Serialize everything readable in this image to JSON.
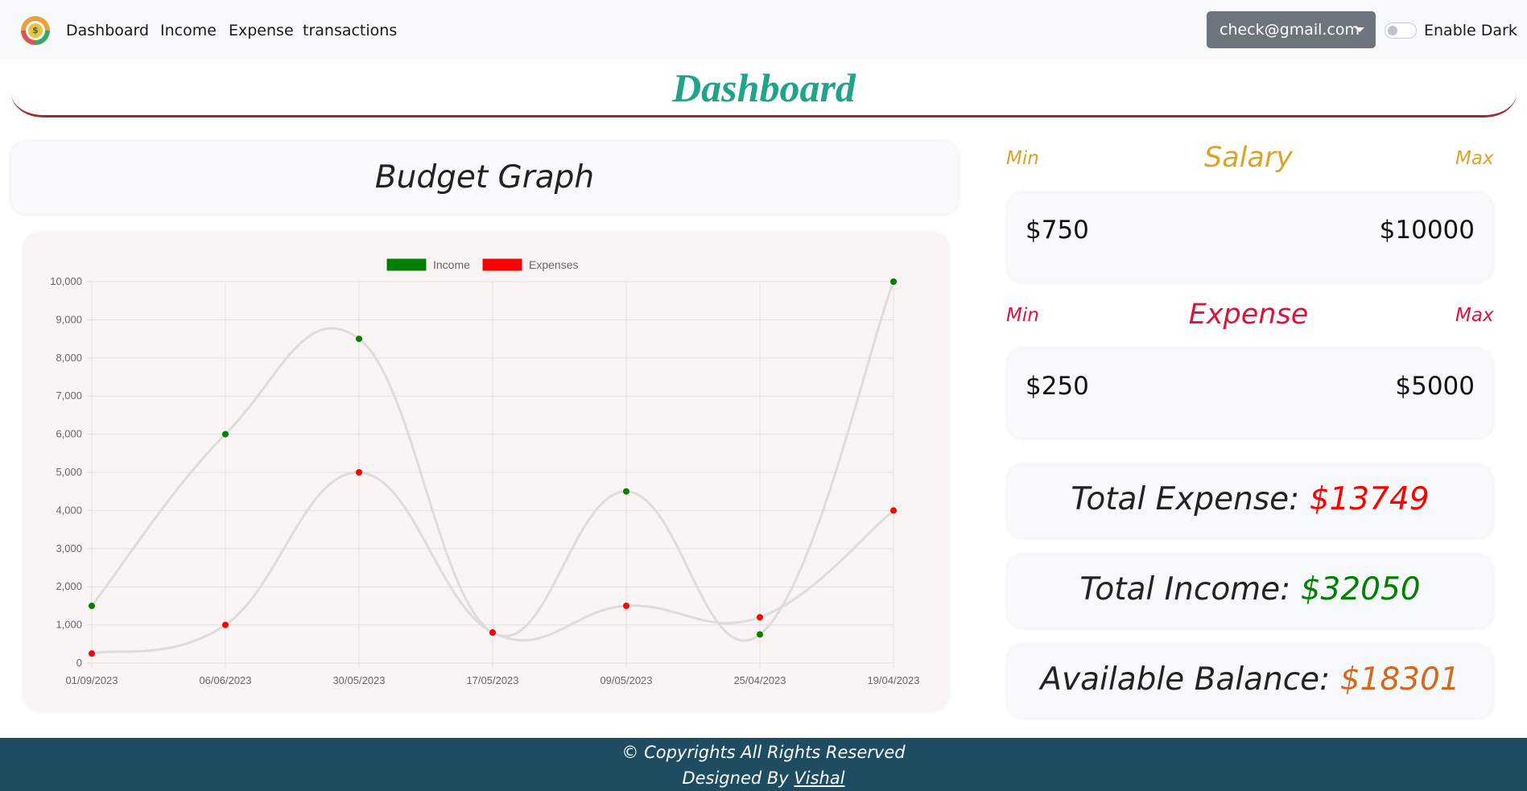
{
  "nav": {
    "logo_symbol": "$",
    "links": [
      "Dashboard",
      "Income",
      "Expense",
      "transactions"
    ],
    "user_email": "check@gmail.com",
    "dark_toggle_label": "Enable Dark"
  },
  "page_title": "Dashboard",
  "graph_card": {
    "title": "Budget Graph"
  },
  "chart_data": {
    "type": "line",
    "categories": [
      "01/09/2023",
      "06/06/2023",
      "30/05/2023",
      "17/05/2023",
      "09/05/2023",
      "25/04/2023",
      "19/04/2023"
    ],
    "series": [
      {
        "name": "Income",
        "values": [
          1500,
          6000,
          8500,
          800,
          4500,
          750,
          10000
        ],
        "color": "#008000"
      },
      {
        "name": "Expenses",
        "values": [
          250,
          1000,
          5000,
          800,
          1500,
          1200,
          4000
        ],
        "color": "#ff0000"
      }
    ],
    "ylim": [
      0,
      10000
    ],
    "yticks": [
      "0",
      "1,000",
      "2,000",
      "3,000",
      "4,000",
      "5,000",
      "6,000",
      "7,000",
      "8,000",
      "9,000",
      "10,000"
    ],
    "line_color": "#dcdcdc",
    "grid": true,
    "legend": "top-center",
    "title": "",
    "xlabel": "",
    "ylabel": ""
  },
  "salary": {
    "title": "Salary",
    "min_label": "Min",
    "max_label": "Max",
    "min_value": "$750",
    "max_value": "$10000",
    "color": "#d9a428"
  },
  "expense": {
    "title": "Expense",
    "min_label": "Min",
    "max_label": "Max",
    "min_value": "$250",
    "max_value": "$5000",
    "color": "#dc143c"
  },
  "totals": {
    "expense_label": "Total Expense:",
    "expense_value": "$13749",
    "expense_color": "#ff0000",
    "income_label": "Total Income:",
    "income_value": "$32050",
    "income_color": "#008000",
    "balance_label": "Available Balance:",
    "balance_value": "$18301",
    "balance_color": "#d2691e"
  },
  "footer": {
    "copyright": "© Copyrights All Rights Reserved",
    "designed_by": "Designed By",
    "designer": "Vishal"
  }
}
